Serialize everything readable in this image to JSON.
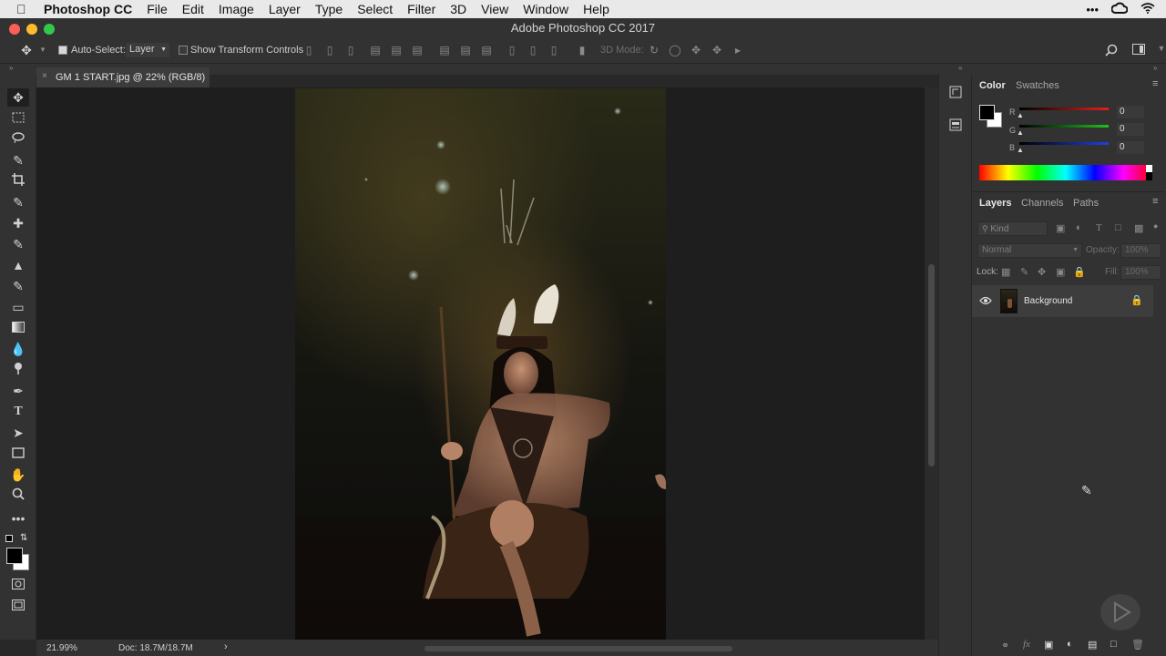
{
  "menubar": {
    "app_name": "Photoshop CC",
    "items": [
      "File",
      "Edit",
      "Image",
      "Layer",
      "Type",
      "Select",
      "Filter",
      "3D",
      "View",
      "Window",
      "Help"
    ],
    "right_icons": [
      "more-icon",
      "creative-cloud-icon",
      "wifi-icon"
    ]
  },
  "window": {
    "title": "Adobe Photoshop CC 2017"
  },
  "options": {
    "auto_select_label": "Auto-Select:",
    "auto_select_value": "Layer",
    "show_transform_label": "Show Transform Controls",
    "mode3d_label": "3D Mode:"
  },
  "document": {
    "tab_title": "GM 1 START.jpg @ 22% (RGB/8)"
  },
  "status": {
    "zoom": "21.99%",
    "doc_size": "Doc: 18.7M/18.7M"
  },
  "color_panel": {
    "tabs": [
      "Color",
      "Swatches"
    ],
    "channels": [
      {
        "label": "R",
        "value": "0"
      },
      {
        "label": "G",
        "value": "0"
      },
      {
        "label": "B",
        "value": "0"
      }
    ]
  },
  "layers_panel": {
    "tabs": [
      "Layers",
      "Channels",
      "Paths"
    ],
    "kind_label": "Kind",
    "blend_mode": "Normal",
    "opacity_label": "Opacity:",
    "opacity_value": "100%",
    "lock_label": "Lock:",
    "fill_label": "Fill:",
    "fill_value": "100%",
    "layers": [
      {
        "name": "Background",
        "visible": true,
        "locked": true
      }
    ]
  },
  "colors": {
    "accent_red": "#e02020",
    "accent_green": "#20c020",
    "accent_blue": "#2040e0",
    "traffic_close": "#fc5f57",
    "traffic_min": "#fdbc2e",
    "traffic_max": "#34c84a"
  }
}
